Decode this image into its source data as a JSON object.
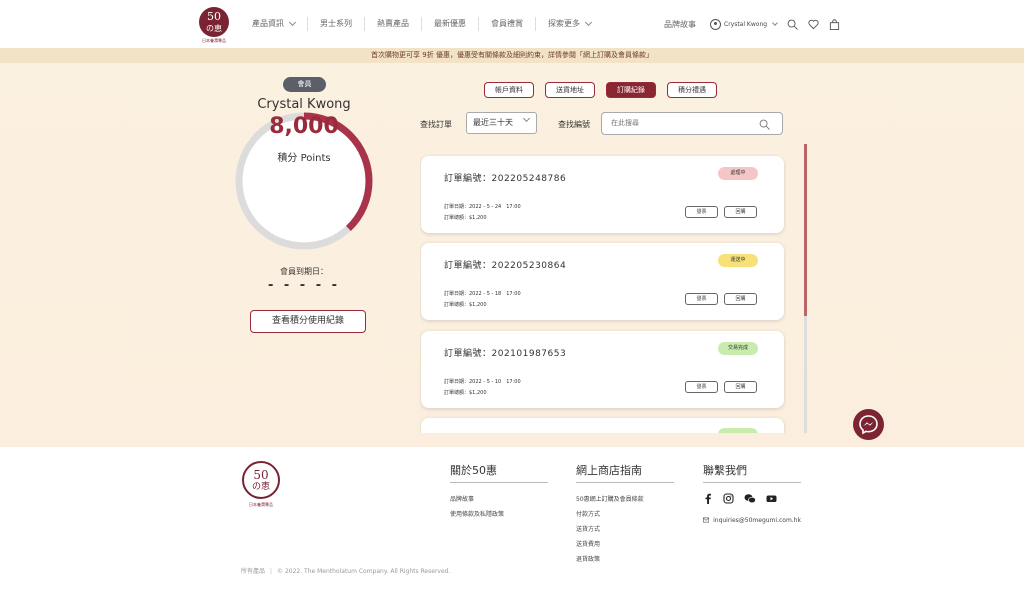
{
  "header": {
    "logo_num": "50",
    "logo_kanji": "の恵",
    "logo_sub": "日本養潤專品",
    "nav": [
      {
        "label": "產品資訊",
        "dropdown": true
      },
      {
        "label": "男士系列",
        "dropdown": false
      },
      {
        "label": "熱賣產品",
        "dropdown": false
      },
      {
        "label": "最新優惠",
        "dropdown": false
      },
      {
        "label": "會員禮賞",
        "dropdown": false
      },
      {
        "label": "探索更多",
        "dropdown": true
      }
    ],
    "brand_story": "品牌故事",
    "user_name": "Crystal Kwong"
  },
  "banner": "首次購物更可享 9折 優惠，優惠受有關條款及細則約束，詳情參閱「網上訂購及會員條款」",
  "tabs": [
    {
      "label": "帳戶資料",
      "active": false
    },
    {
      "label": "送貨地址",
      "active": false
    },
    {
      "label": "訂購紀錄",
      "active": true
    },
    {
      "label": "積分禮遇",
      "active": false
    }
  ],
  "member": {
    "badge": "會員",
    "name": "Crystal Kwong",
    "points": "8,000",
    "points_label": "積分 Points",
    "points_progress": 0.38,
    "expiry_label": "會員到期日：",
    "expiry_value": "- - - - -",
    "history_button": "查看積分使用紀錄"
  },
  "filter": {
    "order_label": "查找訂單",
    "period": "最近三十天",
    "number_label": "查找編號",
    "search_placeholder": "在此搜尋"
  },
  "orders": [
    {
      "number": "訂單編號：202205248786",
      "status": "處理中",
      "status_color": "#f5c6c6",
      "date": "訂單日期：2022 - 5 - 24　17:00",
      "total": "訂單總額：$1,200",
      "invoice": "發票",
      "reorder": "回購"
    },
    {
      "number": "訂單編號：202205230864",
      "status": "運送中",
      "status_color": "#f7e27a",
      "date": "訂單日期：2022 - 5 - 18　17:00",
      "total": "訂單總額：$1,200",
      "invoice": "發票",
      "reorder": "回購"
    },
    {
      "number": "訂單編號：202101987653",
      "status": "交易完成",
      "status_color": "#c9ecae",
      "date": "訂單日期：2022 - 5 - 10　17:00",
      "total": "訂單總額：$1,200",
      "invoice": "發票",
      "reorder": "回購"
    },
    {
      "status_color": "#c9ecae"
    }
  ],
  "footer": {
    "logo_num": "50",
    "logo_kanji": "の恵",
    "logo_sub": "日本養潤專品",
    "about": {
      "title": "關於50惠",
      "links": [
        "品牌故事",
        "使用條款及私隱政策"
      ]
    },
    "guide": {
      "title": "網上商店指南",
      "links": [
        "50惠網上訂購及會員條款",
        "付款方式",
        "送貨方式",
        "送貨費用",
        "退貨政策"
      ]
    },
    "contact": {
      "title": "聯繫我們",
      "social": [
        "facebook-icon",
        "instagram-icon",
        "wechat-icon",
        "youtube-icon"
      ],
      "email": "inquiries@50megumi.com.hk"
    },
    "all_products": "所有產品",
    "copyright": "© 2022. The Mentholatum Company. All Rights Reserved."
  },
  "colors": {
    "accent": "#9a2b3b",
    "banner_bg": "#f3e3c6",
    "main_bg": "#fbf1e0"
  }
}
